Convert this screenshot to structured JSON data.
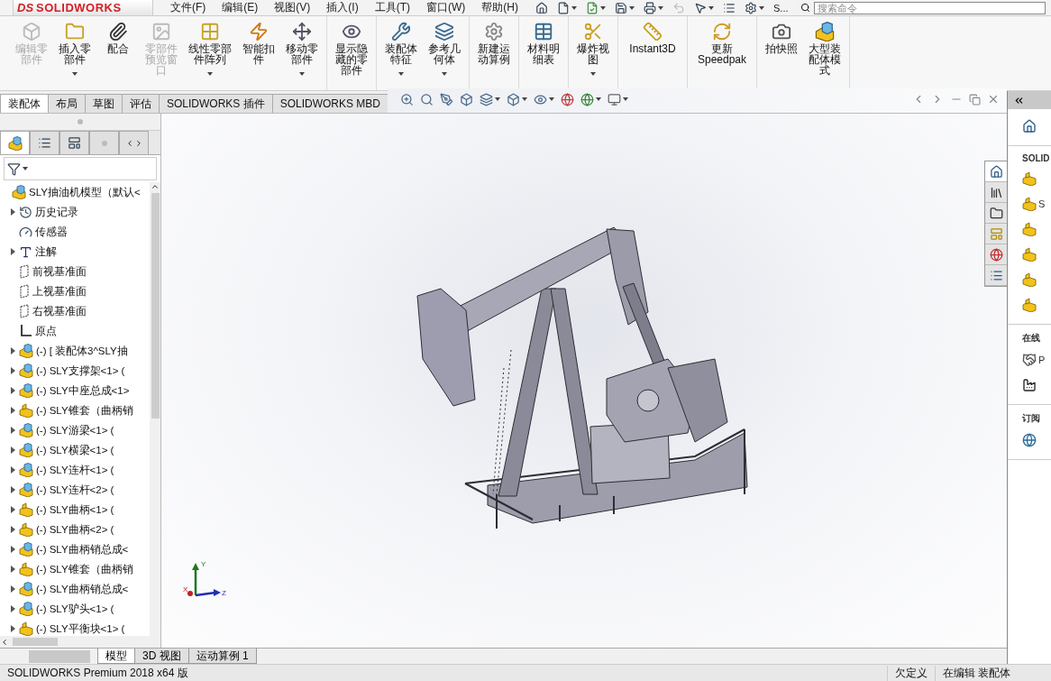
{
  "titlebar": {
    "logo_mark": "DS",
    "logo": "SOLIDWORKS",
    "menu": [
      "文件(F)",
      "编辑(E)",
      "视图(V)",
      "插入(I)",
      "工具(T)",
      "窗口(W)",
      "帮助(H)"
    ],
    "overflow": "S...",
    "search": {
      "placeholder": "搜索命令"
    }
  },
  "ribbon": [
    [
      {
        "label": "编辑零部件",
        "disabled": true,
        "dropdown": false
      },
      {
        "label": "插入零部件",
        "disabled": false,
        "dropdown": true
      },
      {
        "label": "配合",
        "disabled": false,
        "dropdown": false
      },
      {
        "label": "零部件预览窗口",
        "disabled": true,
        "dropdown": false
      },
      {
        "label": "线性零部件阵列",
        "disabled": false,
        "dropdown": true
      },
      {
        "label": "智能扣件",
        "disabled": false,
        "dropdown": false
      },
      {
        "label": "移动零部件",
        "disabled": false,
        "dropdown": true
      }
    ],
    [
      {
        "label": "显示隐藏的零部件",
        "disabled": false,
        "dropdown": false
      }
    ],
    [
      {
        "label": "装配体特征",
        "disabled": false,
        "dropdown": true
      },
      {
        "label": "参考几何体",
        "disabled": false,
        "dropdown": true
      }
    ],
    [
      {
        "label": "新建运动算例",
        "disabled": false,
        "dropdown": false
      }
    ],
    [
      {
        "label": "材料明细表",
        "disabled": false,
        "dropdown": false
      }
    ],
    [
      {
        "label": "爆炸视图",
        "disabled": false,
        "dropdown": true
      }
    ],
    [
      {
        "label": "Instant3D",
        "disabled": false,
        "dropdown": false
      }
    ],
    [
      {
        "label": "更新Speedpak",
        "disabled": false,
        "dropdown": false
      }
    ],
    [
      {
        "label": "拍快照",
        "disabled": false,
        "dropdown": false
      },
      {
        "label": "大型装配体模式",
        "disabled": false,
        "dropdown": false
      }
    ]
  ],
  "tabs": [
    {
      "label": "装配体",
      "selected": true
    },
    {
      "label": "布局",
      "selected": false
    },
    {
      "label": "草图",
      "selected": false
    },
    {
      "label": "评估",
      "selected": false
    },
    {
      "label": "SOLIDWORKS 插件",
      "selected": false
    },
    {
      "label": "SOLIDWORKS MBD",
      "selected": false
    }
  ],
  "tree": {
    "label": "SLY抽油机模型（默认<",
    "kind": "assembly",
    "expandable": false,
    "children": [
      {
        "label": "历史记录",
        "kind": "history",
        "expandable": true
      },
      {
        "label": "传感器",
        "kind": "sensor",
        "expandable": false
      },
      {
        "label": "注解",
        "kind": "annotation",
        "expandable": true
      },
      {
        "label": "前视基准面",
        "kind": "plane",
        "expandable": false
      },
      {
        "label": "上视基准面",
        "kind": "plane",
        "expandable": false
      },
      {
        "label": "右视基准面",
        "kind": "plane",
        "expandable": false
      },
      {
        "label": "原点",
        "kind": "origin",
        "expandable": false
      },
      {
        "label": "(-) [ 装配体3^SLY抽",
        "kind": "assembly",
        "expandable": true
      },
      {
        "label": "(-) SLY支撑架<1> (",
        "kind": "assembly",
        "expandable": true
      },
      {
        "label": "(-) SLY中座总成<1>",
        "kind": "assembly",
        "expandable": true
      },
      {
        "label": "(-) SLY锥套（曲柄销",
        "kind": "part",
        "expandable": true
      },
      {
        "label": "(-) SLY游梁<1> (",
        "kind": "assembly",
        "expandable": true
      },
      {
        "label": "(-) SLY横梁<1> (",
        "kind": "assembly",
        "expandable": true
      },
      {
        "label": "(-) SLY连杆<1> (",
        "kind": "assembly",
        "expandable": true
      },
      {
        "label": "(-) SLY连杆<2> (",
        "kind": "assembly",
        "expandable": true
      },
      {
        "label": "(-) SLY曲柄<1> (",
        "kind": "part",
        "expandable": true
      },
      {
        "label": "(-) SLY曲柄<2> (",
        "kind": "part",
        "expandable": true
      },
      {
        "label": "(-) SLY曲柄销总成<",
        "kind": "assembly",
        "expandable": true
      },
      {
        "label": "(-) SLY锥套（曲柄销",
        "kind": "part",
        "expandable": true
      },
      {
        "label": "(-) SLY曲柄销总成<",
        "kind": "assembly",
        "expandable": true
      },
      {
        "label": "(-) SLY驴头<1> (",
        "kind": "assembly",
        "expandable": true
      },
      {
        "label": "(-) SLY平衡块<1> (",
        "kind": "part",
        "expandable": true
      }
    ]
  },
  "triad": {
    "x": "X",
    "y": "Y",
    "z": "Z"
  },
  "task_pane": {
    "sections": [
      {
        "title": "SOLID",
        "items": [
          {
            "kind": "icon"
          },
          {
            "kind": "link",
            "label": "S"
          },
          {
            "kind": "icon"
          },
          {
            "kind": "icon"
          },
          {
            "kind": "icon"
          },
          {
            "kind": "icon"
          }
        ]
      },
      {
        "title": "在线",
        "items": [
          {
            "kind": "link",
            "label": "P"
          },
          {
            "kind": "icon"
          }
        ]
      },
      {
        "title": "订阅",
        "items": [
          {
            "kind": "icon"
          }
        ]
      }
    ]
  },
  "bottom_tabs": [
    {
      "label": "模型",
      "selected": true
    },
    {
      "label": "3D 视图",
      "selected": false
    },
    {
      "label": "运动算例 1",
      "selected": false
    }
  ],
  "status_bar": {
    "product": "SOLIDWORKS Premium 2018 x64 版",
    "definition": "欠定义",
    "mode": "在编辑 装配体"
  }
}
